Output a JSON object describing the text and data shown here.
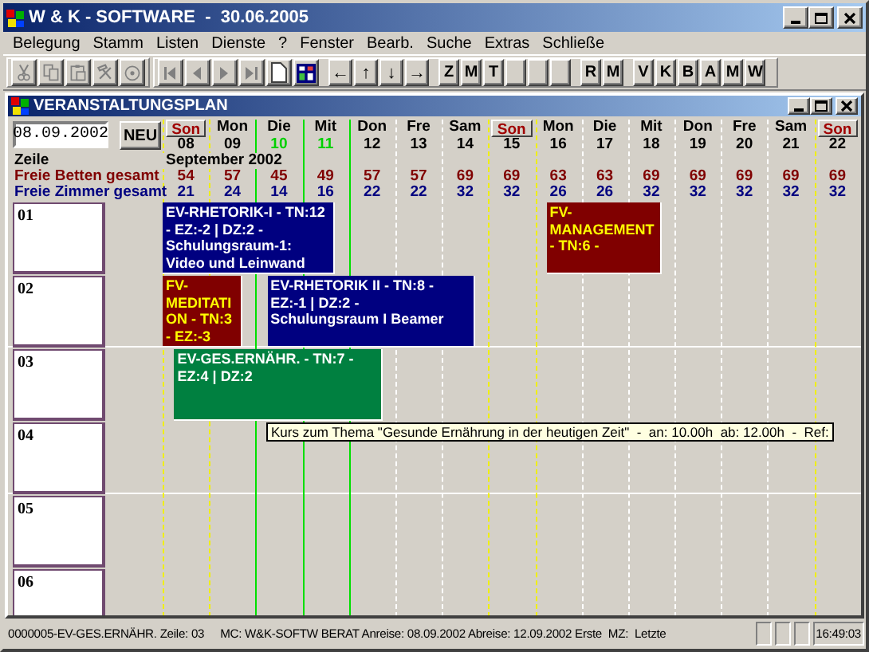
{
  "window": {
    "title": "W & K - SOFTWARE  -  30.06.2005"
  },
  "menu": [
    "Belegung",
    "Stamm",
    "Listen",
    "Dienste",
    "?",
    "Fenster",
    "Bearb.",
    "Suche",
    "Extras",
    "Schließe"
  ],
  "toolbar": {
    "edit_buttons": [
      {
        "disabled": true
      },
      {
        "disabled": true
      },
      {
        "disabled": true
      },
      {
        "disabled": true
      },
      {
        "disabled": true
      }
    ],
    "nav_buttons": [
      {
        "disabled": true
      },
      {
        "disabled": true
      },
      {
        "disabled": true
      },
      {
        "disabled": true
      }
    ],
    "arrow_buttons": [
      "←",
      "↑",
      "↓",
      "→"
    ],
    "letter_groups": [
      [
        "Z",
        "M",
        "T"
      ],
      [
        "R",
        "M"
      ],
      [
        "V",
        "K",
        "B",
        "A",
        "M",
        "W"
      ]
    ]
  },
  "planner": {
    "title": "VERANSTALTUNGSPLAN",
    "date": "08.09.2002",
    "new_button": "NEU",
    "row_header": "Zeile",
    "month": "September 2002",
    "days": [
      {
        "name": "Son",
        "date": "08",
        "sunday": true,
        "highlighted": false
      },
      {
        "name": "Mon",
        "date": "09",
        "sunday": false,
        "highlighted": false
      },
      {
        "name": "Die",
        "date": "10",
        "sunday": false,
        "highlighted": true
      },
      {
        "name": "Mit",
        "date": "11",
        "sunday": false,
        "highlighted": true
      },
      {
        "name": "Don",
        "date": "12",
        "sunday": false,
        "highlighted": false
      },
      {
        "name": "Fre",
        "date": "13",
        "sunday": false,
        "highlighted": false
      },
      {
        "name": "Sam",
        "date": "14",
        "sunday": false,
        "highlighted": false
      },
      {
        "name": "Son",
        "date": "15",
        "sunday": true,
        "highlighted": false
      },
      {
        "name": "Mon",
        "date": "16",
        "sunday": false,
        "highlighted": false
      },
      {
        "name": "Die",
        "date": "17",
        "sunday": false,
        "highlighted": false
      },
      {
        "name": "Mit",
        "date": "18",
        "sunday": false,
        "highlighted": false
      },
      {
        "name": "Don",
        "date": "19",
        "sunday": false,
        "highlighted": false
      },
      {
        "name": "Fre",
        "date": "20",
        "sunday": false,
        "highlighted": false
      },
      {
        "name": "Sam",
        "date": "21",
        "sunday": false,
        "highlighted": false
      },
      {
        "name": "Son",
        "date": "22",
        "sunday": true,
        "highlighted": false
      }
    ],
    "free_beds": {
      "label": "Freie Betten gesamt",
      "values": [
        "54",
        "57",
        "45",
        "49",
        "57",
        "57",
        "69",
        "69",
        "63",
        "63",
        "69",
        "69",
        "69",
        "69",
        "69"
      ]
    },
    "free_rooms": {
      "label": "Freie Zimmer gesamt",
      "values": [
        "21",
        "24",
        "14",
        "16",
        "22",
        "22",
        "32",
        "32",
        "26",
        "26",
        "32",
        "32",
        "32",
        "32",
        "32"
      ]
    },
    "rows": [
      {
        "label": "01",
        "events": [
          {
            "text": "EV-RHETORIK-I - TN:12 - EZ:-2 | DZ:2 - Schulungsraum-1: Video und Leinwand",
            "kind": "ev",
            "color": "#000080"
          },
          {
            "text": "FV-MANAGEMENT - TN:6 -",
            "kind": "fv",
            "color": "#800000"
          }
        ]
      },
      {
        "label": "02",
        "events": [
          {
            "text": "FV-MEDITATION - TN:3 - EZ:-3",
            "kind": "fv",
            "color": "#800000"
          },
          {
            "text": "EV-RHETORIK II - TN:8 - EZ:-1 | DZ:2 - Schulungsraum I Beamer",
            "kind": "ev",
            "color": "#000080"
          }
        ]
      },
      {
        "label": "03",
        "events": [
          {
            "text": "EV-GES.ERNÄHR. - TN:7 - EZ:4 | DZ:2",
            "kind": "ev",
            "color": "#008040"
          }
        ]
      },
      {
        "label": "04",
        "events": []
      },
      {
        "label": "05",
        "events": []
      },
      {
        "label": "06",
        "events": []
      }
    ],
    "tooltip": "Kurs zum Thema \"Gesunde Ernährung in der heutigen Zeit\"  -  an: 10.00h  ab: 12.00h  -  Ref:"
  },
  "status_bar": {
    "record": "0000005-EV-GES.ERNÄHR. Zeile: 03",
    "info": "MC: W&K-SOFTW BERAT Anreise: 08.09.2002 Abreise: 12.09.2002 Erste  MZ:  Letzte",
    "time": "16:49:03"
  }
}
